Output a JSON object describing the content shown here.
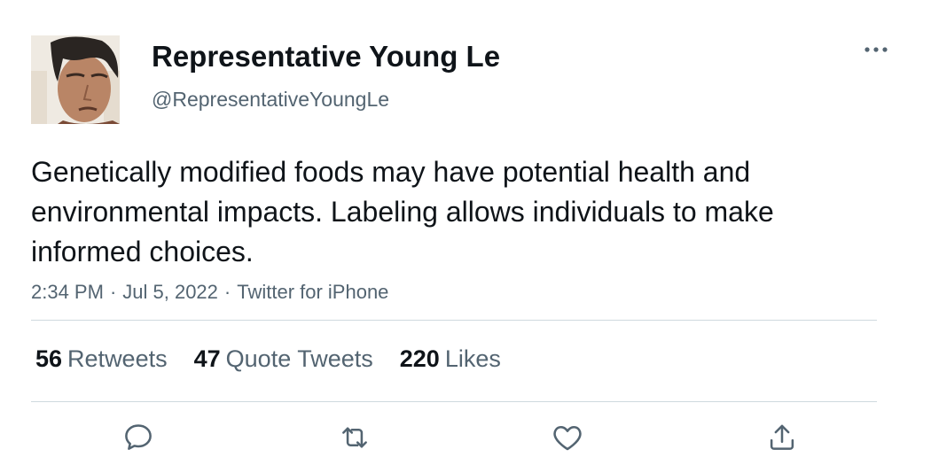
{
  "author": {
    "display_name": "Representative Young Le",
    "handle": "@RepresentativeYoungLe",
    "avatar": "profile-photo"
  },
  "tweet": {
    "text": "Genetically modified foods may have potential health and environmental impacts. Labeling allows individuals to make informed choices.",
    "time": "2:34 PM",
    "date": "Jul 5, 2022",
    "source": "Twitter for iPhone",
    "separator": "·"
  },
  "stats": {
    "retweets": {
      "count": "56",
      "label": "Retweets"
    },
    "quotes": {
      "count": "47",
      "label": "Quote Tweets"
    },
    "likes": {
      "count": "220",
      "label": "Likes"
    }
  },
  "actions": {
    "reply_icon": "speech-bubble-icon",
    "retweet_icon": "retweet-arrows-icon",
    "like_icon": "heart-icon",
    "share_icon": "share-upload-icon",
    "more_icon": "ellipsis-icon"
  },
  "colors": {
    "text_primary": "#0f1419",
    "text_secondary": "#536471",
    "divider": "#cfd9de",
    "background": "#ffffff"
  }
}
